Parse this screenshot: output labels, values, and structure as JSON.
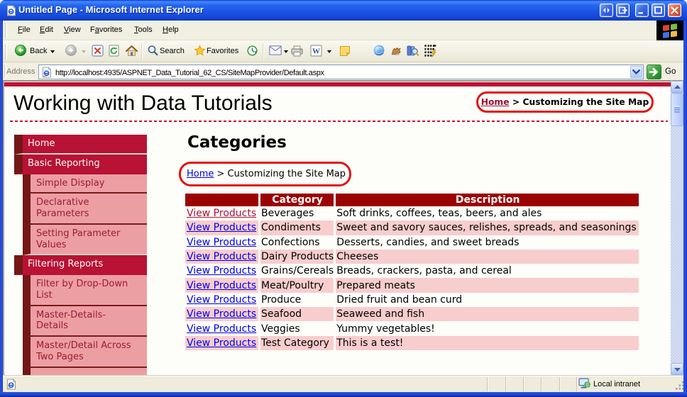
{
  "window": {
    "title": "Untitled Page - Microsoft Internet Explorer",
    "buttons": [
      "pan-left-right",
      "pop-out",
      "minimize",
      "maximize",
      "close"
    ]
  },
  "menubar": {
    "items": [
      {
        "label": "File",
        "accel": "F"
      },
      {
        "label": "Edit",
        "accel": "E"
      },
      {
        "label": "View",
        "accel": "V"
      },
      {
        "label": "Favorites",
        "accel": "a"
      },
      {
        "label": "Tools",
        "accel": "T"
      },
      {
        "label": "Help",
        "accel": "H"
      }
    ]
  },
  "toolbar": {
    "back_label": "Back",
    "search_label": "Search",
    "favorites_label": "Favorites",
    "icons": [
      "back-icon",
      "forward-icon",
      "stop-icon",
      "refresh-icon",
      "home-icon",
      "search-icon",
      "favorites-icon",
      "history-icon",
      "mail-icon",
      "print-icon",
      "edit-word-icon",
      "messenger-note-icon",
      "messenger-sphere-icon",
      "fox-addon-icon",
      "research-icon",
      "script-debugger-icon"
    ]
  },
  "addressbar": {
    "label": "Address",
    "url": "http://localhost:4935/ASPNET_Data_Tutorial_62_CS/SiteMapProvider/Default.aspx",
    "go_label": "Go"
  },
  "statusbar": {
    "zone": "Local intranet"
  },
  "page": {
    "header_title": "Working with Data Tutorials",
    "breadcrumb": {
      "home": "Home",
      "rest": " > Customizing the Site Map"
    },
    "heading": "Categories",
    "sidebar": [
      {
        "label": "Home",
        "level": 0,
        "sep": "light"
      },
      {
        "label": "Basic Reporting",
        "level": 0,
        "sep": "none"
      },
      {
        "label": "Simple Display",
        "level": 1,
        "sep": "dark"
      },
      {
        "label": "Declarative Parameters",
        "level": 1,
        "sep": "dark"
      },
      {
        "label": "Setting Parameter Values",
        "level": 1,
        "sep": "light"
      },
      {
        "label": "Filtering Reports",
        "level": 0,
        "sep": "none"
      },
      {
        "label": "Filter by Drop-Down List",
        "level": 1,
        "sep": "dark"
      },
      {
        "label": "Master-Details-Details",
        "level": 1,
        "sep": "dark"
      },
      {
        "label": "Master/Detail Across Two Pages",
        "level": 1,
        "sep": "dark"
      },
      {
        "label": "",
        "level": 1,
        "sep": "none"
      }
    ],
    "table": {
      "link_label": "View Products",
      "headers": [
        "",
        "Category",
        "Description"
      ],
      "rows": [
        {
          "category": "Beverages",
          "description": "Soft drinks, coffees, teas, beers, and ales",
          "visited": true
        },
        {
          "category": "Condiments",
          "description": "Sweet and savory sauces, relishes, spreads, and seasonings",
          "visited": false
        },
        {
          "category": "Confections",
          "description": "Desserts, candies, and sweet breads",
          "visited": false
        },
        {
          "category": "Dairy Products",
          "description": "Cheeses",
          "visited": false
        },
        {
          "category": "Grains/Cereals",
          "description": "Breads, crackers, pasta, and cereal",
          "visited": false
        },
        {
          "category": "Meat/Poultry",
          "description": "Prepared meats",
          "visited": false
        },
        {
          "category": "Produce",
          "description": "Dried fruit and bean curd",
          "visited": false
        },
        {
          "category": "Seafood",
          "description": "Seaweed and fish",
          "visited": false
        },
        {
          "category": "Veggies",
          "description": "Yummy vegetables!",
          "visited": false
        },
        {
          "category": "Test Category",
          "description": "This is a test!",
          "visited": false
        }
      ]
    },
    "colors": {
      "accent_crimson": "#B81234",
      "dark_maroon_strip": "#731717",
      "table_header": "#9B0202",
      "table_alt_row": "#F8CDCD",
      "annotation_red": "#E31212",
      "link_blue": "#0000EE",
      "link_maroon": "#A8123A"
    }
  }
}
